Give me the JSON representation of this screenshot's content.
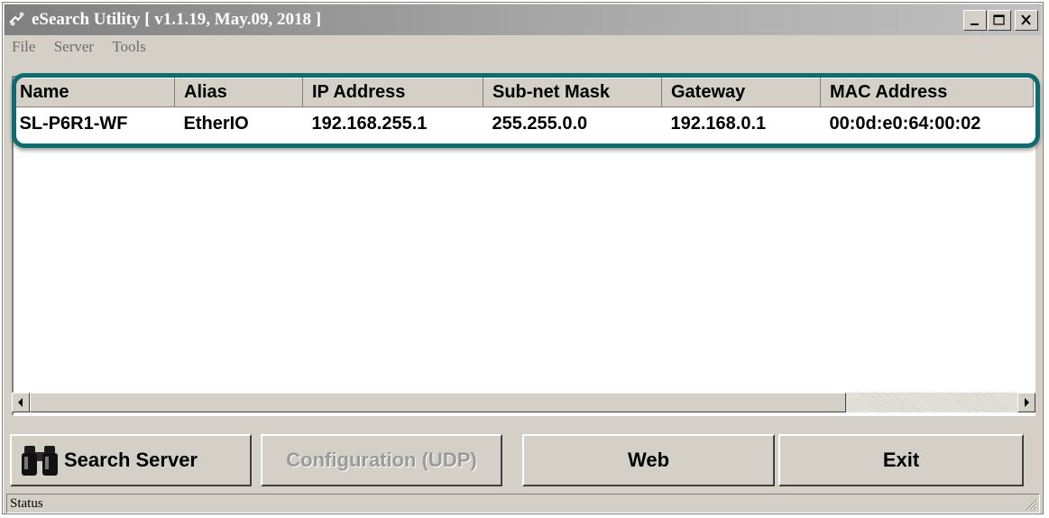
{
  "window": {
    "title": "eSearch Utility [ v1.1.19, May.09, 2018 ]",
    "icons": {
      "app": "network-app-icon",
      "minimize": "minimize-icon",
      "maximize": "maximize-icon",
      "close": "close-icon"
    }
  },
  "menu": {
    "items": [
      {
        "label": "File"
      },
      {
        "label": "Server"
      },
      {
        "label": "Tools"
      }
    ]
  },
  "table": {
    "columns": [
      "Name",
      "Alias",
      "IP Address",
      "Sub-net Mask",
      "Gateway",
      "MAC Address"
    ],
    "rows": [
      [
        "SL-P6R1-WF",
        "EtherIO",
        "192.168.255.1",
        "255.255.0.0",
        "192.168.0.1",
        "00:0d:e0:64:00:02"
      ]
    ]
  },
  "buttons": {
    "search_server": "Search Server",
    "configuration": "Configuration (UDP)",
    "web": "Web",
    "exit": "Exit",
    "search_icon": "binoculars-icon"
  },
  "status": {
    "text": "Status"
  },
  "colors": {
    "highlight_border": "#0e6b6f",
    "window_face": "#d4d0c8"
  }
}
